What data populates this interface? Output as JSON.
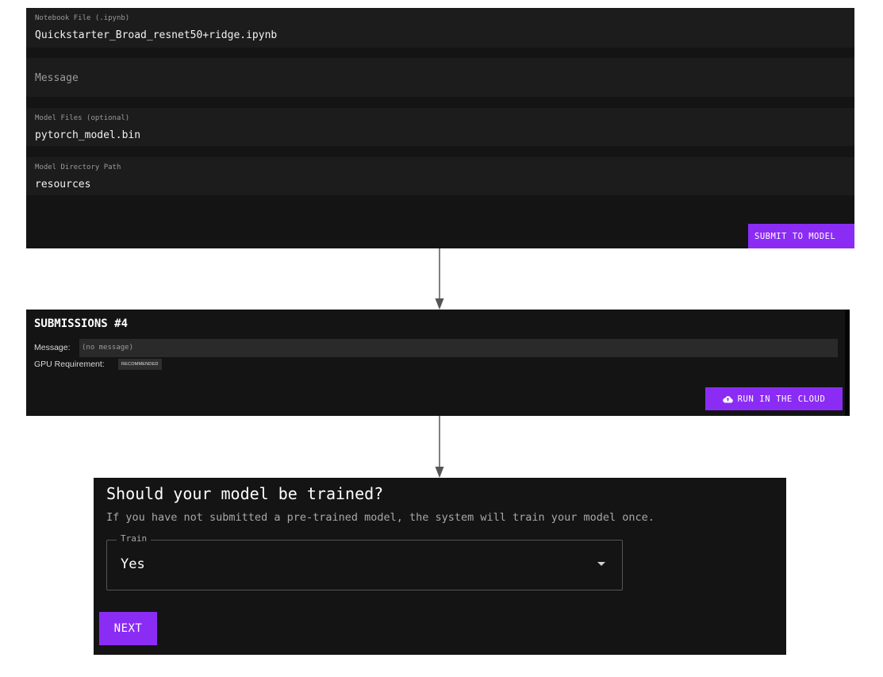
{
  "form": {
    "notebook_file": {
      "label": "Notebook File (.ipynb)",
      "value": "Quickstarter_Broad_resnet50+ridge.ipynb"
    },
    "message": {
      "placeholder": "Message"
    },
    "model_files": {
      "label": "Model Files (optional)",
      "value": "pytorch_model.bin"
    },
    "model_directory": {
      "label": "Model Directory Path",
      "value": "resources"
    },
    "submit_label": "SUBMIT TO MODEL"
  },
  "submissions": {
    "title": "SUBMISSIONS #4",
    "message_label": "Message:",
    "message_value": "(no message)",
    "gpu_label": "GPU Requirement:",
    "gpu_badge": "RECOMMENDED",
    "cloud_button_label": "RUN IN THE CLOUD",
    "cloud_icon": "cloud-upload-icon"
  },
  "training": {
    "title": "Should your model be trained?",
    "subtitle": "If you have not submitted a pre-trained model, the system will train your model once.",
    "select_label": "Train",
    "select_value": "Yes",
    "next_label": "NEXT"
  },
  "colors": {
    "panel_bg": "#141414",
    "field_bg": "#1c1c1c",
    "accent": "#8b2cf5",
    "arrow": "#555555"
  }
}
